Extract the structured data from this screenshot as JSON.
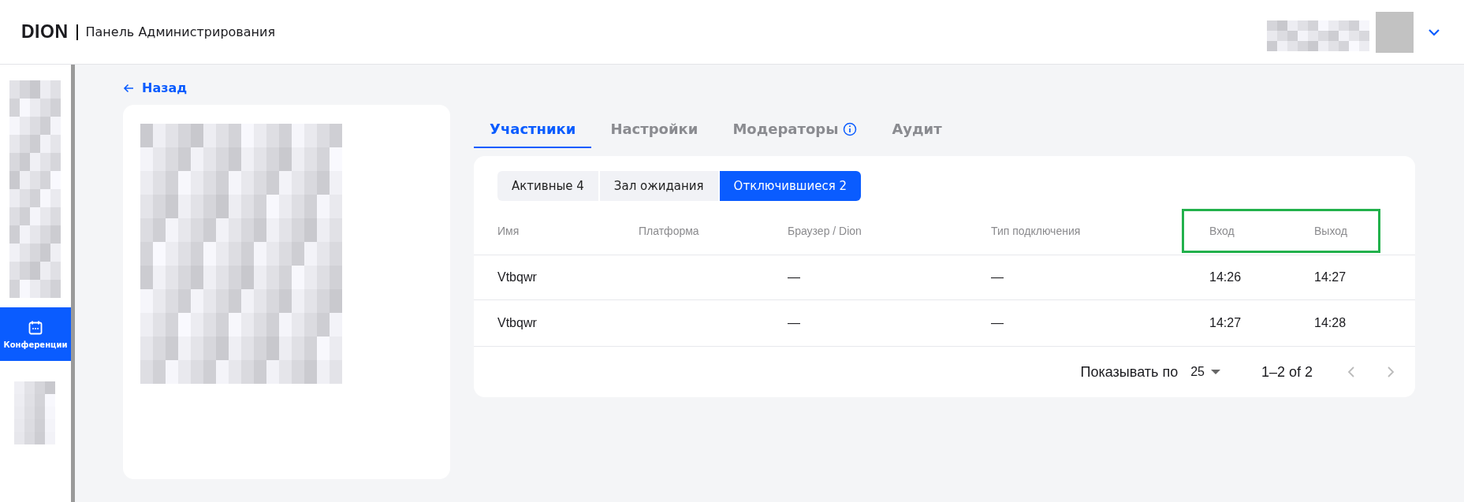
{
  "header": {
    "logo": "DION",
    "title": "Панель Администрирования"
  },
  "sidebar": {
    "items": [
      {
        "label": "Конференции",
        "selected": true
      }
    ]
  },
  "back_link": "Назад",
  "tabs": [
    {
      "label": "Участники",
      "selected": true,
      "info": false
    },
    {
      "label": "Настройки",
      "selected": false,
      "info": false
    },
    {
      "label": "Модераторы",
      "selected": false,
      "info": true
    },
    {
      "label": "Аудит",
      "selected": false,
      "info": false
    }
  ],
  "subtabs": [
    {
      "label": "Активные 4",
      "selected": false
    },
    {
      "label": "Зал ожидания",
      "selected": false
    },
    {
      "label": "Отключившиеся 2",
      "selected": true
    }
  ],
  "table": {
    "columns": [
      {
        "label": "Имя",
        "highlighted": false
      },
      {
        "label": "Платформа",
        "highlighted": false
      },
      {
        "label": "Браузер / Dion",
        "highlighted": false
      },
      {
        "label": "Тип подключения",
        "highlighted": false
      },
      {
        "label": "Вход",
        "highlighted": true
      },
      {
        "label": "Выход",
        "highlighted": true
      }
    ],
    "rows": [
      [
        "Vtbqwr",
        "",
        "—",
        "—",
        "14:26",
        "14:27"
      ],
      [
        "Vtbqwr",
        "",
        "—",
        "—",
        "14:27",
        "14:28"
      ]
    ]
  },
  "pagination": {
    "rows_per_page_label": "Показывать по",
    "rows_per_page": "25",
    "range": "1–2 of 2"
  }
}
